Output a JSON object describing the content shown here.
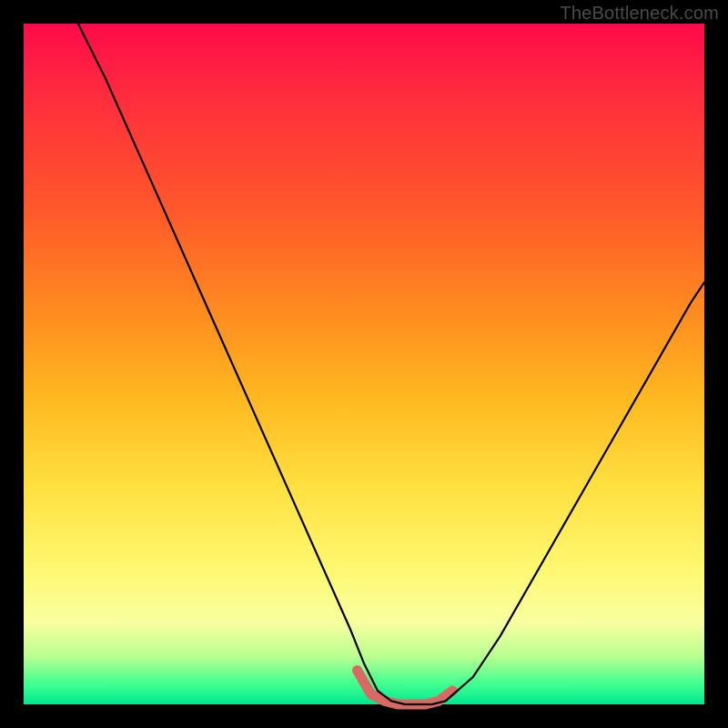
{
  "watermark": "TheBottleneck.com",
  "chart_data": {
    "type": "line",
    "title": "",
    "xlabel": "",
    "ylabel": "",
    "xlim": [
      0,
      100
    ],
    "ylim": [
      0,
      100
    ],
    "series": [
      {
        "name": "main-curve",
        "color": "#000000",
        "x": [
          8,
          12,
          16,
          20,
          24,
          28,
          32,
          36,
          40,
          44,
          48,
          50,
          52,
          54,
          56,
          58,
          60,
          62,
          66,
          70,
          74,
          78,
          82,
          86,
          90,
          94,
          98,
          100
        ],
        "y": [
          100,
          92,
          83,
          74,
          65,
          56,
          47,
          38,
          29,
          20,
          11,
          6,
          2,
          0.5,
          0,
          0,
          0,
          0.5,
          4,
          10,
          17,
          24,
          31,
          38,
          45,
          52,
          59,
          62
        ]
      },
      {
        "name": "bottom-highlight",
        "color": "#d86a63",
        "x": [
          49,
          51,
          53,
          55,
          57,
          59,
          61,
          63
        ],
        "y": [
          5,
          1.5,
          0.5,
          0,
          0,
          0,
          0.5,
          2
        ]
      }
    ]
  }
}
